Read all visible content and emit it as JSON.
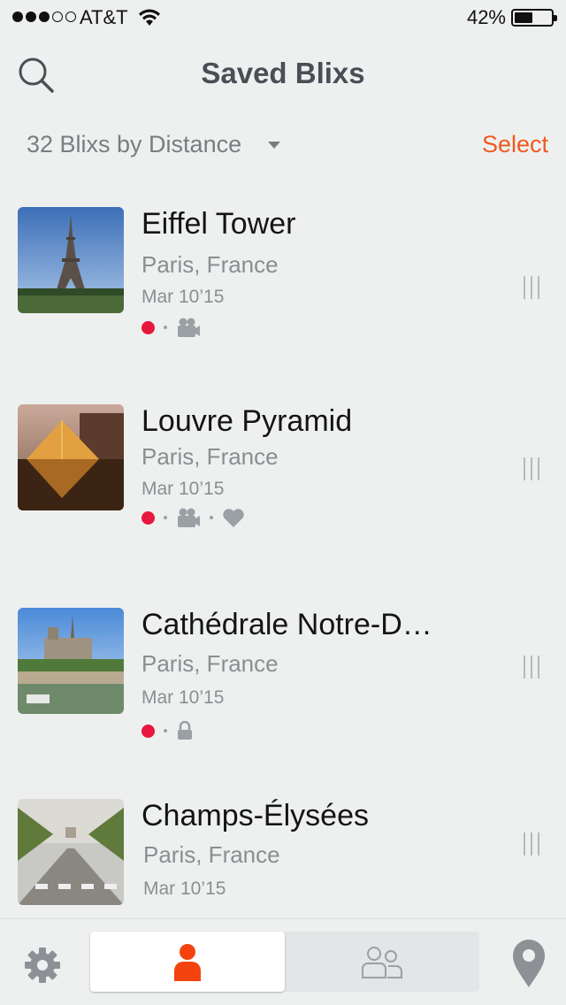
{
  "status_bar": {
    "carrier": "AT&T",
    "battery_percent": "42%",
    "battery_level": 0.42,
    "signal_bars": 3,
    "signal_total": 5
  },
  "header": {
    "title": "Saved Blixs",
    "search_icon": "search-icon"
  },
  "sort": {
    "label": "32 Blixs by Distance",
    "select_label": "Select"
  },
  "colors": {
    "accent": "#f05a1e",
    "record_dot": "#e8173d",
    "title": "#4a4f56",
    "muted": "#8b8e91"
  },
  "items": [
    {
      "title": "Eiffel Tower",
      "location": "Paris, France",
      "date": "Mar 10’15",
      "badges": [
        "red-dot",
        "video-camera-icon"
      ]
    },
    {
      "title": "Louvre Pyramid",
      "location": "Paris, France",
      "date": "Mar 10’15",
      "badges": [
        "red-dot",
        "video-camera-icon",
        "heart-icon"
      ]
    },
    {
      "title": "Cathédrale Notre-D…",
      "location": "Paris, France",
      "date": "Mar 10’15",
      "badges": [
        "red-dot",
        "lock-icon"
      ]
    },
    {
      "title": "Champs-Élysées",
      "location": "Paris, France",
      "date": "Mar 10’15",
      "badges": []
    }
  ],
  "tab_bar": {
    "settings_icon": "gear-icon",
    "me_icon": "person-icon",
    "friends_icon": "people-icon",
    "map_icon": "map-pin-icon",
    "selected": "me"
  }
}
